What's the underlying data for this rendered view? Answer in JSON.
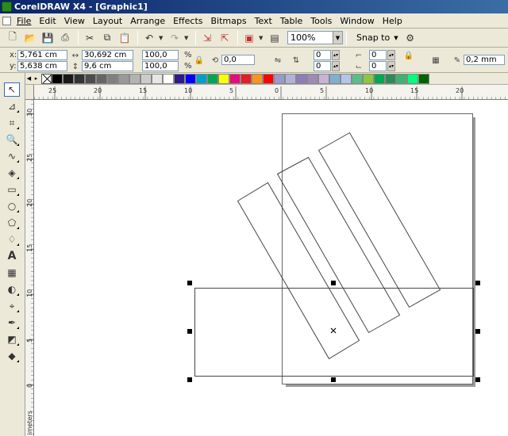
{
  "window": {
    "title": "CorelDRAW X4 - [Graphic1]"
  },
  "menu": [
    "File",
    "Edit",
    "View",
    "Layout",
    "Arrange",
    "Effects",
    "Bitmaps",
    "Text",
    "Table",
    "Tools",
    "Window",
    "Help"
  ],
  "standard_toolbar": {
    "icons": [
      "new-icon",
      "open-icon",
      "save-icon",
      "print-icon",
      "cut-icon",
      "copy-icon",
      "paste-icon",
      "undo-icon",
      "redo-icon",
      "import-icon",
      "export-icon",
      "application-launcher-icon",
      "welcome-screen-icon"
    ],
    "zoom_level": "100%",
    "snap_label": "Snap to",
    "options_icon": "options-icon"
  },
  "property_bar": {
    "x_label": "x:",
    "x_value": "5,761 cm",
    "y_label": "y:",
    "y_value": "5,638 cm",
    "width_value": "30,692 cm",
    "height_value": "9,6 cm",
    "scale_w": "100,0",
    "scale_h": "100,0",
    "percent": "%",
    "rotation": "0,0",
    "corner_values": [
      "0",
      "0",
      "0",
      "0"
    ],
    "outline_width": "0,2 mm"
  },
  "palette": {
    "colors": [
      "#000000",
      "#1a1a1a",
      "#333333",
      "#4d4d4d",
      "#666666",
      "#808080",
      "#999999",
      "#b3b3b3",
      "#cccccc",
      "#e6e6e6",
      "#ffffff",
      "#2e1a8c",
      "#0000ff",
      "#00a0c6",
      "#00a651",
      "#ffff00",
      "#e30e7b",
      "#e31e24",
      "#f7941d",
      "#ff0000",
      "#9999cc",
      "#b2b2d8",
      "#8c7fb8",
      "#9e8ab9",
      "#c9b2d9",
      "#7eb0cf",
      "#b4c6e7",
      "#5dbd8a",
      "#8dc63f",
      "#00a651",
      "#2e8b57",
      "#3cb371",
      "#00ff7f",
      "#006400"
    ]
  },
  "ruler": {
    "h_labels": [
      "25",
      "20",
      "15",
      "10",
      "5",
      "0",
      "5",
      "10",
      "15",
      "20"
    ],
    "v_labels": [
      "30",
      "25",
      "20",
      "15",
      "10",
      "5",
      "0"
    ],
    "unit_label": "imeters"
  },
  "tools": [
    "pick-tool-icon",
    "shape-tool-icon",
    "crop-tool-icon",
    "zoom-tool-icon",
    "freehand-tool-icon",
    "smart-fill-tool-icon",
    "rectangle-tool-icon",
    "ellipse-tool-icon",
    "polygon-tool-icon",
    "basic-shapes-tool-icon",
    "text-tool-icon",
    "table-tool-icon",
    "interactive-blend-tool-icon",
    "eyedropper-tool-icon",
    "outline-tool-icon",
    "fill-tool-icon",
    "interactive-fill-tool-icon"
  ]
}
